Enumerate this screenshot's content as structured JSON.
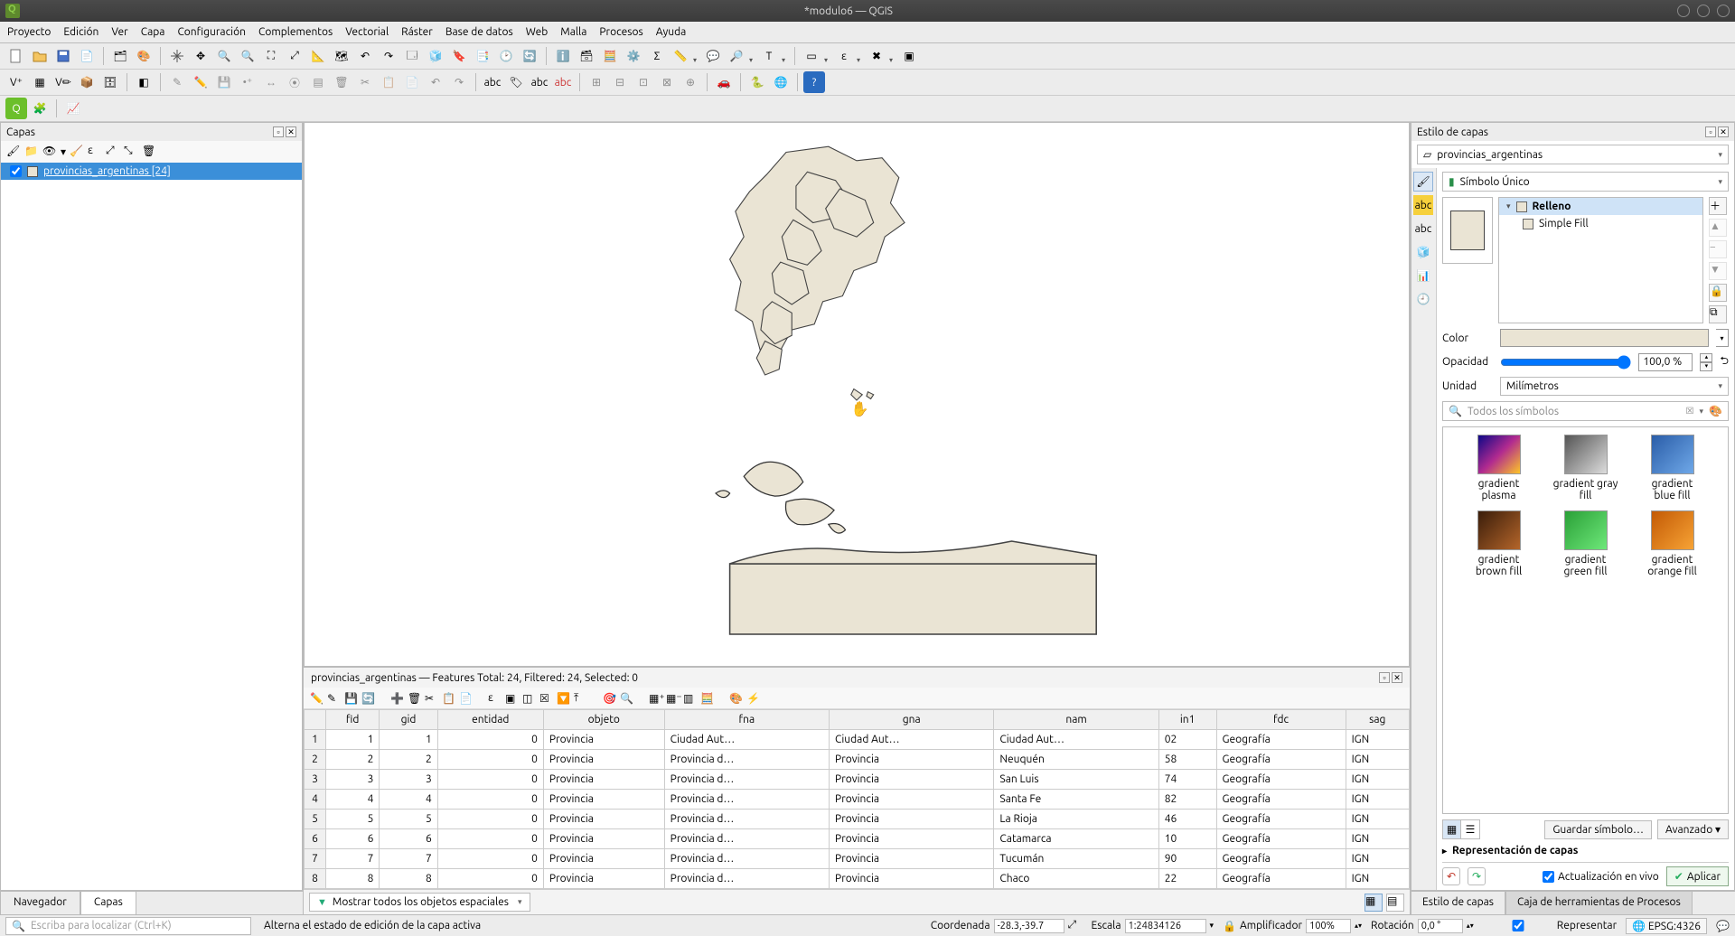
{
  "window": {
    "title": "*modulo6 — QGIS"
  },
  "menubar": [
    "Proyecto",
    "Edición",
    "Ver",
    "Capa",
    "Configuración",
    "Complementos",
    "Vectorial",
    "Ráster",
    "Base de datos",
    "Web",
    "Malla",
    "Procesos",
    "Ayuda"
  ],
  "layers_panel": {
    "title": "Capas",
    "layer_name": "provincias_argentinas [24]"
  },
  "left_tabs": {
    "browser": "Navegador",
    "layers": "Capas"
  },
  "attribute_table": {
    "title": "provincias_argentinas — Features Total: 24, Filtered: 24, Selected: 0",
    "columns": [
      "fid",
      "gid",
      "entidad",
      "objeto",
      "fna",
      "gna",
      "nam",
      "in1",
      "fdc",
      "sag"
    ],
    "rows": [
      {
        "n": "1",
        "fid": "1",
        "gid": "1",
        "entidad": "0",
        "objeto": "Provincia",
        "fna": "Ciudad Aut…",
        "gna": "Ciudad Aut…",
        "nam": "Ciudad Aut…",
        "in1": "02",
        "fdc": "Geografía",
        "sag": "IGN"
      },
      {
        "n": "2",
        "fid": "2",
        "gid": "2",
        "entidad": "0",
        "objeto": "Provincia",
        "fna": "Provincia d…",
        "gna": "Provincia",
        "nam": "Neuquén",
        "in1": "58",
        "fdc": "Geografía",
        "sag": "IGN"
      },
      {
        "n": "3",
        "fid": "3",
        "gid": "3",
        "entidad": "0",
        "objeto": "Provincia",
        "fna": "Provincia d…",
        "gna": "Provincia",
        "nam": "San Luis",
        "in1": "74",
        "fdc": "Geografía",
        "sag": "IGN"
      },
      {
        "n": "4",
        "fid": "4",
        "gid": "4",
        "entidad": "0",
        "objeto": "Provincia",
        "fna": "Provincia d…",
        "gna": "Provincia",
        "nam": "Santa Fe",
        "in1": "82",
        "fdc": "Geografía",
        "sag": "IGN"
      },
      {
        "n": "5",
        "fid": "5",
        "gid": "5",
        "entidad": "0",
        "objeto": "Provincia",
        "fna": "Provincia d…",
        "gna": "Provincia",
        "nam": "La Rioja",
        "in1": "46",
        "fdc": "Geografía",
        "sag": "IGN"
      },
      {
        "n": "6",
        "fid": "6",
        "gid": "6",
        "entidad": "0",
        "objeto": "Provincia",
        "fna": "Provincia d…",
        "gna": "Provincia",
        "nam": "Catamarca",
        "in1": "10",
        "fdc": "Geografía",
        "sag": "IGN"
      },
      {
        "n": "7",
        "fid": "7",
        "gid": "7",
        "entidad": "0",
        "objeto": "Provincia",
        "fna": "Provincia d…",
        "gna": "Provincia",
        "nam": "Tucumán",
        "in1": "90",
        "fdc": "Geografía",
        "sag": "IGN"
      },
      {
        "n": "8",
        "fid": "8",
        "gid": "8",
        "entidad": "0",
        "objeto": "Provincia",
        "fna": "Provincia d…",
        "gna": "Provincia",
        "nam": "Chaco",
        "in1": "22",
        "fdc": "Geografía",
        "sag": "IGN"
      }
    ],
    "filter_label": "Mostrar todos los objetos espaciales"
  },
  "style_panel": {
    "title": "Estilo de capas",
    "layer": "provincias_argentinas",
    "renderer": "Símbolo Único",
    "tree": {
      "fill": "Relleno",
      "simple": "Simple Fill"
    },
    "props": {
      "color_label": "Color",
      "opacity_label": "Opacidad",
      "opacity_value": "100,0 %",
      "unit_label": "Unidad",
      "unit_value": "Milímetros"
    },
    "search_placeholder": "Todos los símbolos",
    "swatches": [
      {
        "cls": "g-plasma",
        "label": "gradient plasma"
      },
      {
        "cls": "g-gray",
        "label": "gradient gray fill"
      },
      {
        "cls": "g-blue",
        "label": "gradient blue fill"
      },
      {
        "cls": "g-brown",
        "label": "gradient brown fill"
      },
      {
        "cls": "g-green",
        "label": "gradient green fill"
      },
      {
        "cls": "g-orange",
        "label": "gradient orange fill"
      }
    ],
    "save_symbol": "Guardar símbolo…",
    "advanced": "Avanzado",
    "layer_repr": "Representación de capas",
    "live_update": "Actualización en vivo",
    "apply": "Aplicar"
  },
  "right_tabs": {
    "style": "Estilo de capas",
    "toolbox": "Caja de herramientas de Procesos"
  },
  "statusbar": {
    "locator_placeholder": "Escriba para localizar (Ctrl+K)",
    "message": "Alterna el estado de edición de la capa activa",
    "coord_label": "Coordenada",
    "coord_value": "-28.3,-39.7",
    "scale_label": "Escala",
    "scale_value": "1:24834126",
    "magnifier_label": "Amplificador",
    "magnifier_value": "100%",
    "rotation_label": "Rotación",
    "rotation_value": "0,0 °",
    "render_label": "Representar",
    "crs": "EPSG:4326"
  }
}
